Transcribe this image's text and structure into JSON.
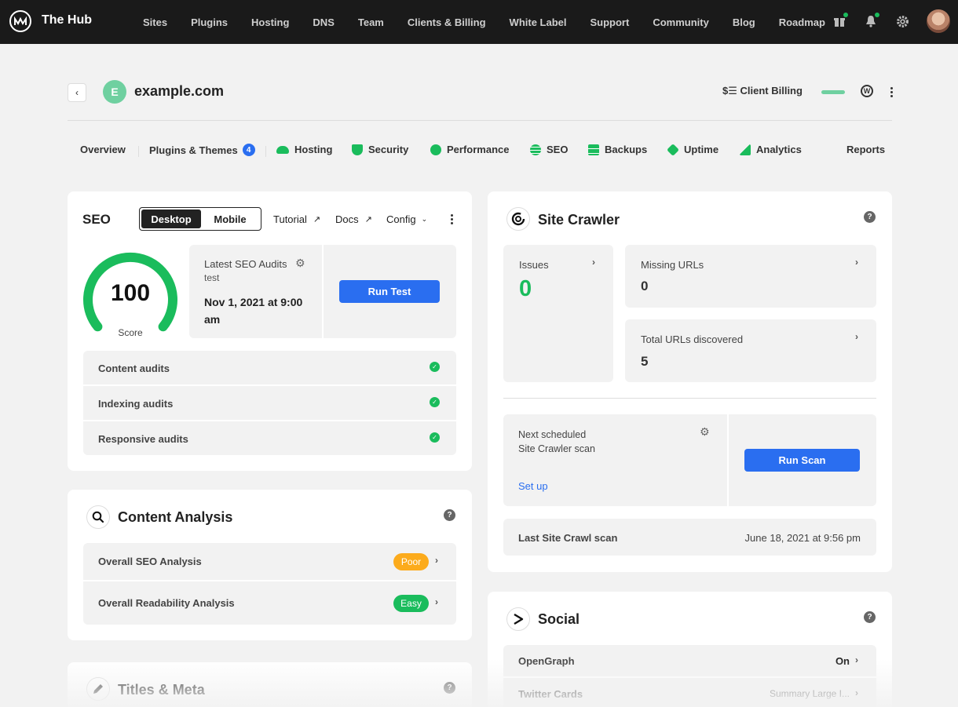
{
  "topbar": {
    "brand": "The Hub",
    "nav": [
      "Sites",
      "Plugins",
      "Hosting",
      "DNS",
      "Team",
      "Clients & Billing",
      "White Label",
      "Support",
      "Community",
      "Blog",
      "Roadmap"
    ]
  },
  "header": {
    "site_initial": "E",
    "site_name": "example.com",
    "client_billing": "$☰ Client Billing"
  },
  "tabs": {
    "overview": "Overview",
    "plugins": "Plugins & Themes",
    "plugins_count": "4",
    "hosting": "Hosting",
    "security": "Security",
    "performance": "Performance",
    "seo": "SEO",
    "backups": "Backups",
    "uptime": "Uptime",
    "analytics": "Analytics",
    "reports": "Reports"
  },
  "seo": {
    "title": "SEO",
    "toggle_desktop": "Desktop",
    "toggle_mobile": "Mobile",
    "tutorial": "Tutorial",
    "docs": "Docs",
    "config": "Config",
    "score": "100",
    "score_label": "Score",
    "latest_label": "Latest SEO Audits",
    "latest_sub": "test",
    "latest_date": "Nov 1, 2021 at 9:00 am",
    "run_test": "Run Test",
    "audits": [
      "Content audits",
      "Indexing audits",
      "Responsive audits"
    ]
  },
  "content_analysis": {
    "title": "Content Analysis",
    "rows": [
      {
        "label": "Overall SEO Analysis",
        "badge": "Poor",
        "color": "#fcab1c"
      },
      {
        "label": "Overall Readability Analysis",
        "badge": "Easy",
        "color": "#1abc5c"
      }
    ]
  },
  "titles_meta": {
    "title": "Titles & Meta"
  },
  "site_crawler": {
    "title": "Site Crawler",
    "issues_label": "Issues",
    "issues_value": "0",
    "missing_label": "Missing URLs",
    "missing_value": "0",
    "total_label": "Total URLs discovered",
    "total_value": "5",
    "next_label_1": "Next scheduled",
    "next_label_2": "Site Crawler scan",
    "setup": "Set up",
    "run_scan": "Run Scan",
    "last_label": "Last Site Crawl scan",
    "last_value": "June 18, 2021 at 9:56 pm"
  },
  "social": {
    "title": "Social",
    "rows": [
      {
        "label": "OpenGraph",
        "value": "On"
      },
      {
        "label": "Twitter Cards",
        "value": "Summary Large I..."
      }
    ]
  },
  "colors": {
    "accent": "#2a6ef0",
    "success": "#1abc5c",
    "warning": "#fcab1c"
  }
}
